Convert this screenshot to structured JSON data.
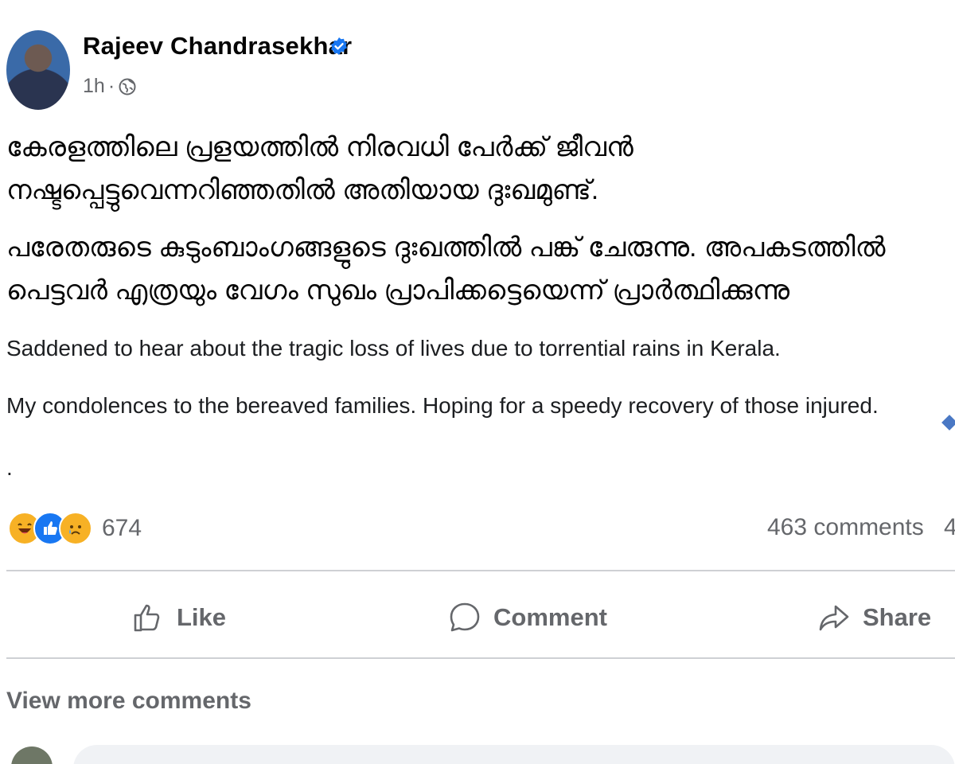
{
  "post": {
    "author": "Rajeev Chandrasekhar",
    "time": "1h",
    "separator": "·",
    "malayalam_lines": [
      "കേരളത്തിലെ പ്രളയത്തിൽ നിരവധി പേർക്ക് ജീവൻ",
      "നഷ്ടപ്പെട്ടുവെന്നറിഞ്ഞതിൽ അതിയായ ദുഃഖമുണ്ട്.",
      "പരേതരുടെ കുടുംബാംഗങ്ങളുടെ ദുഃഖത്തിൽ പങ്ക് ചേരുന്നു. അപകടത്തിൽ",
      "പെട്ടവർ എത്രയും വേഗം സുഖം പ്രാപിക്കട്ടെയെന്ന്  പ്രാർത്ഥിക്കുന്നു"
    ],
    "english_lines": [
      "Saddened to hear about the tragic loss of lives due to torrential rains in Kerala.",
      "My condolences to the bereaved families. Hoping for a speedy recovery of those injured."
    ],
    "trailing": "."
  },
  "stats": {
    "reaction_count": "674",
    "comments": "463 comments",
    "shares": "4"
  },
  "actions": {
    "like": "Like",
    "comment": "Comment",
    "share": "Share"
  },
  "comments_section": {
    "view_more": "View more comments"
  },
  "icons": {
    "verified": "verified-badge-icon",
    "privacy": "globe-icon",
    "reactions": [
      "haha-reaction-icon",
      "like-reaction-icon",
      "sad-reaction-icon"
    ],
    "like": "thumbs-up-icon",
    "comment": "speech-bubble-icon",
    "share": "share-arrow-icon"
  },
  "colors": {
    "verified": "#1877f2",
    "muted_text": "#65676b",
    "like_reaction": "#1877f2",
    "haha_reaction": "#f7b125"
  }
}
